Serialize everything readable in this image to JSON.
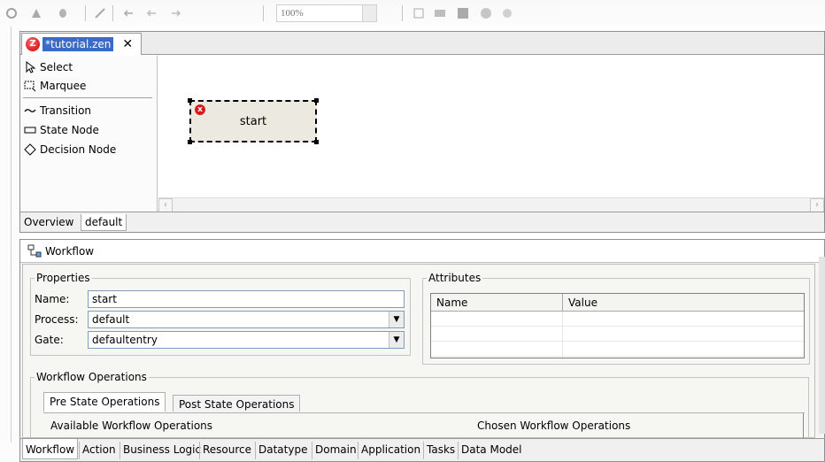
{
  "toolbar": {
    "zoom_value": "100%"
  },
  "editor": {
    "tab_title": "*tutorial.zen",
    "palette": [
      {
        "label": "Select",
        "icon": "arrow-pointer-icon"
      },
      {
        "label": "Marquee",
        "icon": "marquee-icon"
      },
      {
        "label": "Transition",
        "icon": "transition-line-icon"
      },
      {
        "label": "State Node",
        "icon": "state-node-icon"
      },
      {
        "label": "Decision Node",
        "icon": "diamond-icon"
      }
    ],
    "node": {
      "label": "start",
      "error_badge": "x"
    },
    "bottom_tabs": [
      "Overview",
      "default"
    ]
  },
  "workflow": {
    "title": "Workflow",
    "properties": {
      "title": "Properties",
      "name_label": "Name:",
      "name_value": "start",
      "process_label": "Process:",
      "process_value": "default",
      "gate_label": "Gate:",
      "gate_value": "defaultentry"
    },
    "attributes": {
      "title": "Attributes",
      "columns": [
        "Name",
        "Value"
      ]
    },
    "operations": {
      "title": "Workflow Operations",
      "tabs": [
        "Pre State Operations",
        "Post State Operations"
      ],
      "available_label": "Available Workflow Operations",
      "chosen_label": "Chosen Workflow Operations"
    },
    "bottom_tabs": [
      "Workflow",
      "Action",
      "Business Logic",
      "Resource",
      "Datatype",
      "Domain",
      "Application",
      "Tasks",
      "Data Model"
    ]
  }
}
